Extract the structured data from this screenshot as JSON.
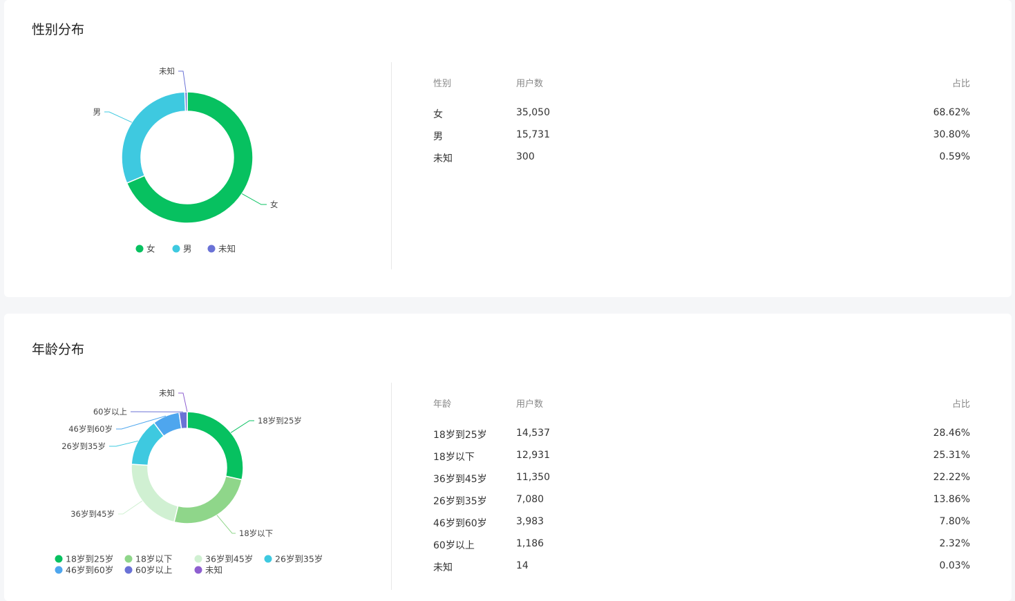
{
  "gender_section": {
    "title": "性别分布",
    "table": {
      "headers": [
        "性别",
        "用户数",
        "占比"
      ],
      "rows": [
        [
          "女",
          "35,050",
          "68.62%"
        ],
        [
          "男",
          "15,731",
          "30.80%"
        ],
        [
          "未知",
          "300",
          "0.59%"
        ]
      ]
    }
  },
  "age_section": {
    "title": "年龄分布",
    "table": {
      "headers": [
        "年龄",
        "用户数",
        "占比"
      ],
      "rows": [
        [
          "18岁到25岁",
          "14,537",
          "28.46%"
        ],
        [
          "18岁以下",
          "12,931",
          "25.31%"
        ],
        [
          "36岁到45岁",
          "11,350",
          "22.22%"
        ],
        [
          "26岁到35岁",
          "7,080",
          "13.86%"
        ],
        [
          "46岁到60岁",
          "3,983",
          "7.80%"
        ],
        [
          "60岁以上",
          "1,186",
          "2.32%"
        ],
        [
          "未知",
          "14",
          "0.03%"
        ]
      ]
    }
  },
  "chart_data": [
    {
      "type": "pie",
      "categories": [
        "女",
        "男",
        "未知"
      ],
      "values": [
        35050,
        15731,
        300
      ],
      "colors": [
        "#07c160",
        "#3ec9e0",
        "#6a72d6"
      ],
      "legend": [
        "女",
        "男",
        "未知"
      ],
      "legend_position": "bottom"
    },
    {
      "type": "pie",
      "categories": [
        "18岁到25岁",
        "18岁以下",
        "36岁到45岁",
        "26岁到35岁",
        "46岁到60岁",
        "60岁以上",
        "未知"
      ],
      "values": [
        14537,
        12931,
        11350,
        7080,
        3983,
        1186,
        14
      ],
      "colors": [
        "#07c160",
        "#8fd68a",
        "#d0f0d2",
        "#3ec9e0",
        "#4ea6ee",
        "#6a72d6",
        "#8e5fd0"
      ],
      "legend": [
        "18岁到25岁",
        "18岁以下",
        "36岁到45岁",
        "26岁到35岁",
        "46岁到60岁",
        "60岁以上",
        "未知"
      ],
      "legend_position": "bottom"
    }
  ]
}
